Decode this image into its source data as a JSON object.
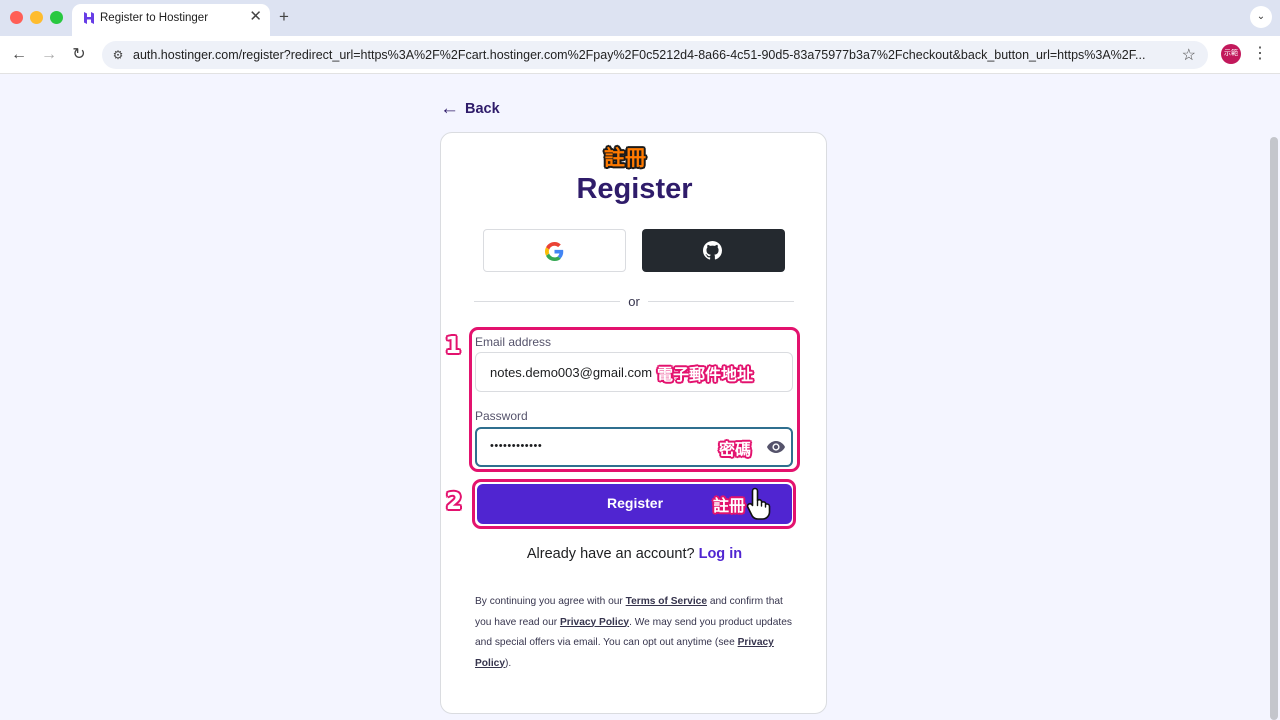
{
  "browser": {
    "tab_title": "Register to Hostinger",
    "tab_close": "✕",
    "new_tab": "+",
    "tab_dropdown": "⌄",
    "url": "auth.hostinger.com/register?redirect_url=https%3A%2F%2Fcart.hostinger.com%2Fpay%2F0c5212d4-8a66-4c51-90d5-83a75977b3a7%2Fcheckout&back_button_url=https%3A%2F...",
    "profile_label": "示範",
    "back": "←",
    "forward": "→",
    "reload": "↻",
    "star": "☆",
    "menu": "⋮",
    "site_info": "⚙"
  },
  "page": {
    "back_arrow": "←",
    "back_label": "Back",
    "title_annotation": "註冊",
    "title": "Register",
    "or": "or",
    "email_label": "Email address",
    "email_value": "notes.demo003@gmail.com",
    "email_annotation": "電子郵件地址",
    "password_label": "Password",
    "password_value": "••••••••••••",
    "password_annotation": "密碼",
    "step_1": "1",
    "step_2": "2",
    "register_label": "Register",
    "register_annotation": "註冊",
    "login_prompt": "Already have an account?",
    "login_link": "Log in",
    "legal": {
      "t1": "By continuing you agree with our ",
      "terms": "Terms of Service",
      "t2": " and confirm that you have read our ",
      "privacy1": "Privacy Policy",
      "t3": ". We may send you product updates and special offers via email. You can opt out anytime (see ",
      "privacy2": "Privacy Policy",
      "t4": ")."
    }
  },
  "icons": {
    "tab_favicon": "hostinger-logo",
    "google": "google-icon",
    "github": "github-icon",
    "eye": "eye-icon",
    "hand": "hand-pointer-icon"
  },
  "colors": {
    "brand_purple": "#5025d1",
    "title_navy": "#2f1c6a",
    "annotation_pink": "#e3126e",
    "github_dark": "#24292f"
  }
}
